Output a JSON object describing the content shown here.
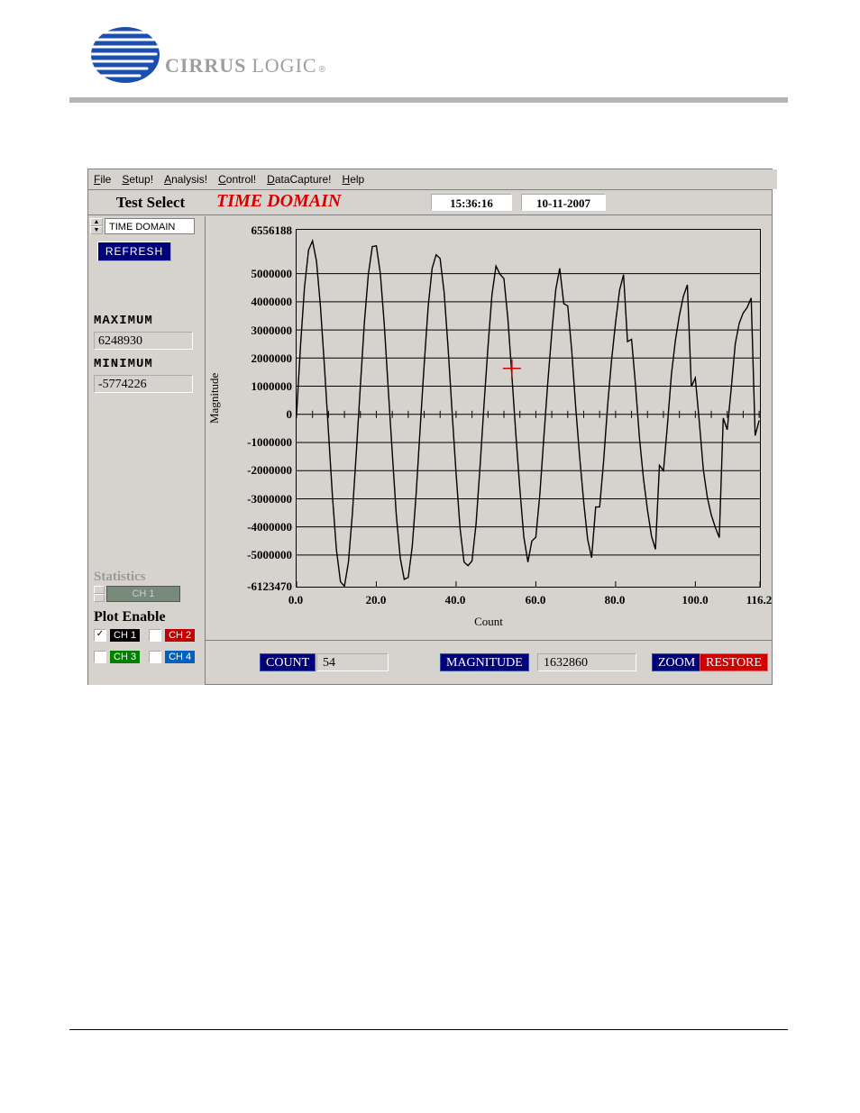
{
  "logo": {
    "word1": "CIRRUS",
    "word2": "LOGIC",
    "reg": "®"
  },
  "menubar": [
    "File",
    "Setup!",
    "Analysis!",
    "Control!",
    "DataCapture!",
    "Help"
  ],
  "header": {
    "test_select_label": "Test Select",
    "mode_title": "TIME DOMAIN",
    "time": "15:36:16",
    "date": "10-11-2007"
  },
  "sidebar": {
    "spinner_value": "TIME DOMAIN",
    "refresh_label": "REFRESH",
    "max_label": "MAXIMUM",
    "max_value": "6248930",
    "min_label": "MINIMUM",
    "min_value": "-5774226",
    "stats_label": "Statistics",
    "stats_channel": "CH 1",
    "plot_enable_label": "Plot Enable",
    "channels": [
      {
        "label": "CH 1",
        "checked": true,
        "color": "black"
      },
      {
        "label": "CH 2",
        "checked": false,
        "color": "red"
      },
      {
        "label": "CH 3",
        "checked": false,
        "color": "green"
      },
      {
        "label": "CH 4",
        "checked": false,
        "color": "blue"
      }
    ]
  },
  "plot": {
    "ylabel": "Magnitude",
    "xlabel": "Count",
    "yticks": [
      "6556188",
      "5000000",
      "4000000",
      "3000000",
      "2000000",
      "1000000",
      "0",
      "-1000000",
      "-2000000",
      "-3000000",
      "-4000000",
      "-5000000",
      "-6123470"
    ],
    "xticks": [
      "0.0",
      "20.0",
      "40.0",
      "60.0",
      "80.0",
      "100.0",
      "116.2"
    ]
  },
  "bottom": {
    "count_label": "COUNT",
    "count_value": "54",
    "mag_label": "MAGNITUDE",
    "mag_value": "1632860",
    "zoom_label": "ZOOM",
    "restore_label": "RESTORE"
  },
  "chart_data": {
    "type": "line",
    "title": "TIME DOMAIN",
    "xlabel": "Count",
    "ylabel": "Magnitude",
    "xlim": [
      0.0,
      116.2
    ],
    "ylim": [
      -6123470,
      6556188
    ],
    "yticks": [
      6556188,
      5000000,
      4000000,
      3000000,
      2000000,
      1000000,
      0,
      -1000000,
      -2000000,
      -3000000,
      -4000000,
      -5000000,
      -6123470
    ],
    "xticks": [
      0.0,
      20.0,
      40.0,
      60.0,
      80.0,
      100.0,
      116.2
    ],
    "series": [
      {
        "name": "CH 1",
        "x": [
          0,
          1,
          2,
          3,
          4,
          5,
          6,
          7,
          8,
          9,
          10,
          11,
          12,
          13,
          14,
          15,
          16,
          17,
          18,
          19,
          20,
          21,
          22,
          23,
          24,
          25,
          26,
          27,
          28,
          29,
          30,
          31,
          32,
          33,
          34,
          35,
          36,
          37,
          38,
          39,
          40,
          41,
          42,
          43,
          44,
          45,
          46,
          47,
          48,
          49,
          50,
          51,
          52,
          53,
          54,
          55,
          56,
          57,
          58,
          59,
          60,
          61,
          62,
          63,
          64,
          65,
          66,
          67,
          68,
          69,
          70,
          71,
          72,
          73,
          74,
          75,
          76,
          77,
          78,
          79,
          80,
          81,
          82,
          83,
          84,
          85,
          86,
          87,
          88,
          89,
          90,
          91,
          92,
          93,
          94,
          95,
          96,
          97,
          98,
          99,
          100,
          101,
          102,
          103,
          104,
          105,
          106,
          107,
          108,
          109,
          110,
          111,
          112,
          113,
          114,
          115,
          116
        ],
        "values": [
          0,
          2451383,
          4522295,
          5838531,
          6161269,
          5439255,
          3824484,
          1656361,
          -637929,
          -2914368,
          -4811777,
          -5951373,
          -6106393,
          -5256514,
          -3530538,
          -1281640,
          1023142,
          3258980,
          4974320,
          5960895,
          5984717,
          5007778,
          3184965,
          891135,
          -1395222,
          -3569346,
          -5103198,
          -5864300,
          -5794816,
          -4695688,
          -2792232,
          -489893,
          1749623,
          3839459,
          5196052,
          5669563,
          5536958,
          4325124,
          2349520,
          81712,
          -2081906,
          -4064786,
          -5251782,
          -5375134,
          -5211279,
          -3891116,
          -1865620,
          330858,
          2387555,
          4240660,
          5269580,
          4981748,
          4820381,
          3400153,
          1349226,
          -741477,
          -2663081,
          -4363627,
          -5249125,
          -4500421,
          -4366725,
          -2859350,
          -810184,
          1145793,
          2904191,
          4430060,
          5190466,
          3935247,
          3853396,
          2276373,
          259778,
          -1540140,
          -3109486,
          -4445931,
          -5093593,
          -3293184,
          -3285091,
          -1660619,
          298305,
          1919712,
          3278992,
          4411741,
          4961046,
          2582053,
          2666444,
          1022327,
          -857610,
          -2281052,
          -3412019,
          -4327679,
          -4795669,
          -1810614,
          -2001173,
          -372727,
          1412984,
          2621714,
          3509233,
          4195060,
          4600152,
          989561,
          1293659,
          -281690,
          -1961029,
          -2939210,
          -3571693,
          -4015745,
          -4377635,
          -131462,
          -548822,
          936855,
          2498502,
          3231747,
          3600833,
          3792300,
          4131220,
          -754126,
          -223029
        ],
        "estimated": true
      }
    ],
    "cursor": {
      "x": 54,
      "y": 1632860
    }
  }
}
